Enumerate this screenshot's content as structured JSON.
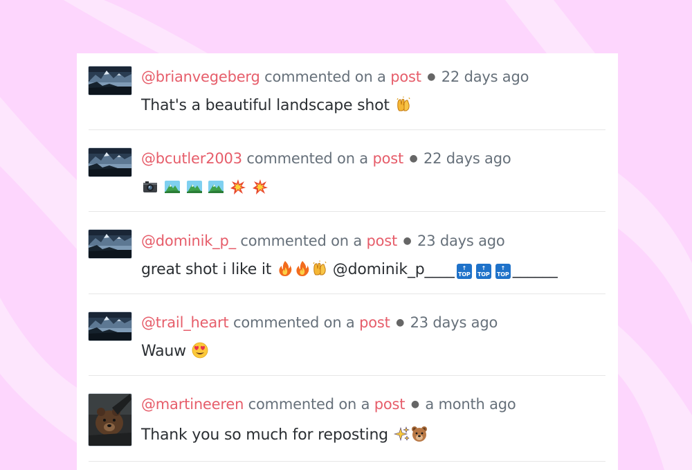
{
  "theme": {
    "background": "#fdd6fd",
    "username_color": "#e65d6a",
    "meta_color": "#66707a",
    "text_color": "#2b2f33"
  },
  "comments": [
    {
      "username": "@brianvegeberg",
      "action": "commented on a",
      "link": "post",
      "time": "22 days ago",
      "text": "That's a beautiful landscape shot",
      "emojis": [
        "raising-hands-emoji"
      ],
      "avatar": "landscape-avatar"
    },
    {
      "username": "@bcutler2003",
      "action": "commented on a",
      "link": "post",
      "time": "22 days ago",
      "text": "",
      "emojis": [
        "camera-emoji",
        "mountain-emoji",
        "mountain-emoji",
        "mountain-emoji",
        "collision-emoji",
        "collision-emoji"
      ],
      "avatar": "landscape-avatar"
    },
    {
      "username": "@dominik_p_",
      "action": "commented on a",
      "link": "post",
      "time": "23 days ago",
      "text": "great shot i like it",
      "emojis": [
        "fire-emoji",
        "fire-emoji",
        "raising-hands-emoji"
      ],
      "mention": "@dominik_p_",
      "tail_a": "___",
      "top_label": "TOP",
      "tail_b": "______",
      "avatar": "landscape-avatar"
    },
    {
      "username": "@trail_heart",
      "action": "commented on a",
      "link": "post",
      "time": "23 days ago",
      "text": "Wauw",
      "emojis": [
        "heart-eyes-emoji"
      ],
      "avatar": "landscape-avatar"
    },
    {
      "username": "@martineeren",
      "action": "commented on a",
      "link": "post",
      "time": "a month ago",
      "text": "Thank you so much for reposting",
      "emojis": [
        "sparkles-emoji",
        "bear-face-emoji"
      ],
      "avatar": "bear-avatar"
    }
  ]
}
